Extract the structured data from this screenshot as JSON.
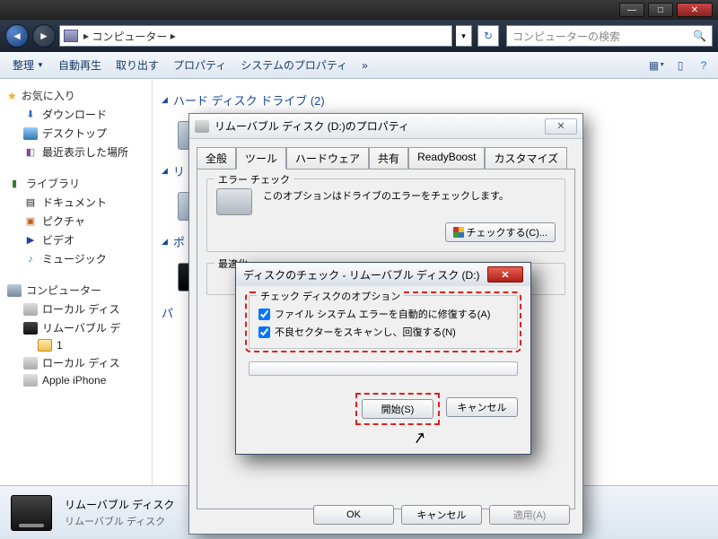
{
  "window": {
    "address_label": "コンピューター",
    "address_chevron": "▸",
    "search_placeholder": "コンピューターの検索"
  },
  "toolbar": {
    "organize": "整理",
    "autoplay": "自動再生",
    "eject": "取り出す",
    "properties": "プロパティ",
    "system_properties": "システムのプロパティ",
    "more": "»"
  },
  "sidebar": {
    "favorites": "お気に入り",
    "downloads": "ダウンロード",
    "desktop": "デスクトップ",
    "recent": "最近表示した場所",
    "libraries": "ライブラリ",
    "documents": "ドキュメント",
    "pictures": "ピクチャ",
    "videos": "ビデオ",
    "music": "ミュージック",
    "computer": "コンピューター",
    "local_disk": "ローカル ディス",
    "removable": "リムーバブル デ",
    "folder1": "1",
    "local_disk2": "ローカル ディス",
    "iphone": "Apple iPhone"
  },
  "content": {
    "hdd_header": "ハード ディスク ドライブ (2)",
    "removable_header": "リ",
    "portable_header": "ポ",
    "p_header": "パ"
  },
  "details": {
    "title": "リムーバブル ディスク",
    "sub": "リムーバブル ディスク"
  },
  "prop_dialog": {
    "title": "リムーバブル ディスク (D:)のプロパティ",
    "tabs": {
      "general": "全般",
      "tools": "ツール",
      "hardware": "ハードウェア",
      "sharing": "共有",
      "readyboost": "ReadyBoost",
      "customize": "カスタマイズ"
    },
    "error_check": {
      "label": "エラー チェック",
      "text": "このオプションはドライブのエラーをチェックします。",
      "button": "チェックする(C)..."
    },
    "defrag": {
      "label": "最適化"
    },
    "buttons": {
      "ok": "OK",
      "cancel": "キャンセル",
      "apply": "適用(A)"
    }
  },
  "chk_dialog": {
    "title": "ディスクのチェック - リムーバブル ディスク (D:)",
    "group_label": "チェック ディスクのオプション",
    "opt1": "ファイル システム エラーを自動的に修復する(A)",
    "opt2": "不良セクターをスキャンし、回復する(N)",
    "start": "開始(S)",
    "cancel": "キャンセル"
  }
}
